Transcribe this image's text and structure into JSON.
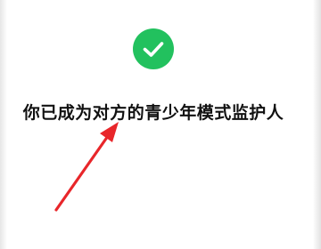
{
  "status": {
    "icon": "check-circle-icon",
    "icon_color": "#22c15e",
    "message": "你已成为对方的青少年模式监护人"
  },
  "annotation": {
    "icon": "red-arrow-icon",
    "color": "#e8262a"
  }
}
